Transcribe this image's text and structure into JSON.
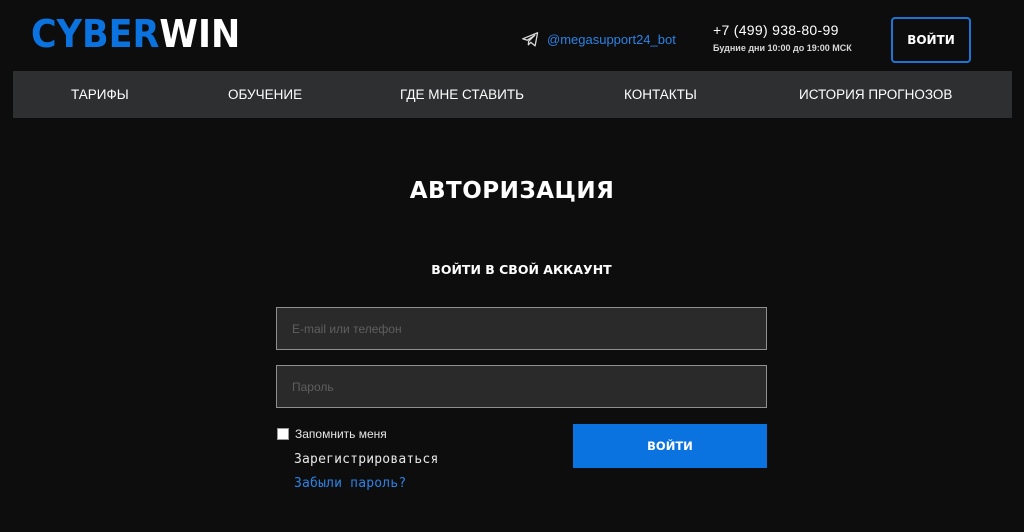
{
  "header": {
    "logo": {
      "part1": "CYBER",
      "part2": "WIN"
    },
    "telegram": {
      "icon": "telegram-icon",
      "handle": "@megasupport24_bot"
    },
    "phone": "+7 (499) 938-80-99",
    "hours": "Будние дни 10:00 до 19:00 МСК",
    "login_label": "ВОЙТИ"
  },
  "nav": {
    "items": [
      {
        "label": "ТАРИФЫ"
      },
      {
        "label": "ОБУЧЕНИЕ"
      },
      {
        "label": "ГДЕ МНЕ СТАВИТЬ"
      },
      {
        "label": "КОНТАКТЫ"
      },
      {
        "label": "ИСТОРИЯ ПРОГНОЗОВ"
      }
    ]
  },
  "auth": {
    "title": "АВТОРИЗАЦИЯ",
    "subtitle": "ВОЙТИ В СВОЙ АККАУНТ",
    "email_placeholder": "E-mail или телефон",
    "email_value": "",
    "password_placeholder": "Пароль",
    "password_value": "",
    "remember_label": "Запомнить меня",
    "remember_checked": false,
    "submit_label": "ВОЙТИ",
    "register_label": "Зарегистрироваться",
    "forgot_label": "Забыли пароль?"
  },
  "colors": {
    "accent": "#0b73e0",
    "background": "#0d0d0e",
    "nav_background": "#2e2f31",
    "link": "#2b82e4"
  }
}
